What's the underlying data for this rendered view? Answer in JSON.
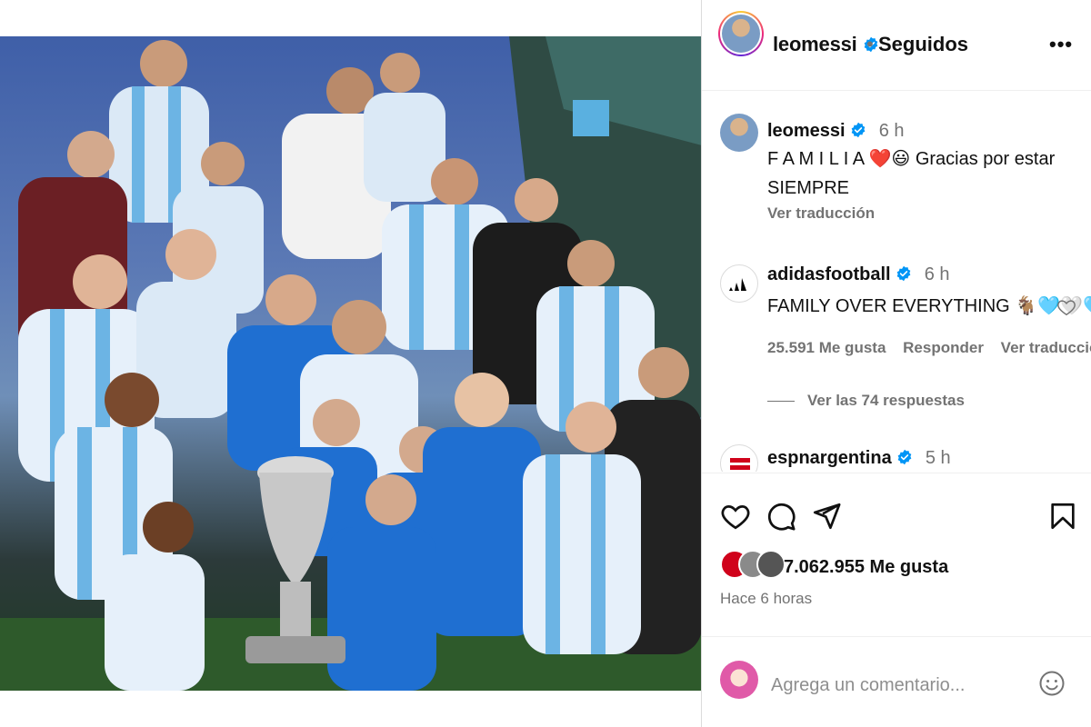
{
  "post": {
    "author": "leomessi",
    "follow_separator": "•",
    "follow_status": "Seguidos",
    "more_label": "•••"
  },
  "comments": [
    {
      "user": "leomessi",
      "time": "6 h",
      "text_line1": "F A M I L I A ❤️😃 Gracias por estar",
      "text_line2": "SIEMPRE",
      "translate": "Ver traducción"
    },
    {
      "user": "adidasfootball",
      "time": "6 h",
      "text": "FAMILY OVER EVERYTHING 🐐🩵🤍🩵",
      "likes": "25.591 Me gusta",
      "reply": "Responder",
      "translate": "Ver traducción",
      "view_replies": "Ver las 74 respuestas"
    },
    {
      "user": "espnargentina",
      "time": "5 h"
    }
  ],
  "actions": {
    "likes": "7.062.955 Me gusta",
    "posted_ago": "Hace 6 horas"
  },
  "composer": {
    "placeholder": "Agrega un comentario..."
  },
  "colors": {
    "verified": "#0095f6",
    "secondary_text": "#737373",
    "divider": "#dbdbdb"
  },
  "icons": [
    "verified-badge-icon",
    "more-options-icon",
    "heart-icon",
    "comment-icon",
    "share-icon",
    "bookmark-icon",
    "emoji-icon"
  ]
}
